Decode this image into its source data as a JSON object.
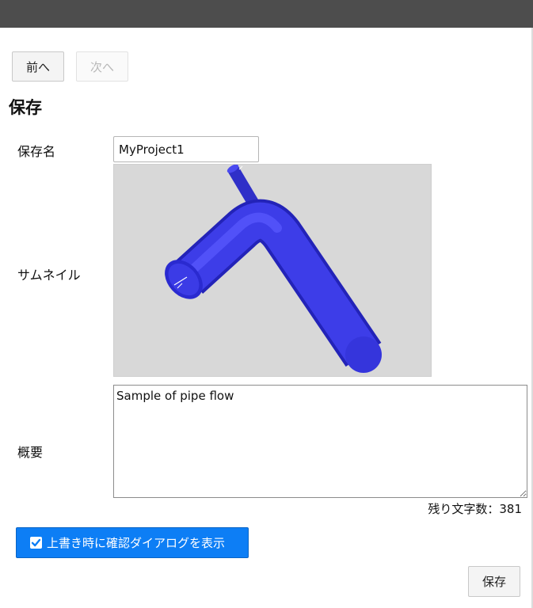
{
  "nav": {
    "prev_label": "前へ",
    "next_label": "次へ"
  },
  "page": {
    "title": "保存"
  },
  "form": {
    "name_label": "保存名",
    "name_value": "MyProject1",
    "thumbnail_label": "サムネイル",
    "description_label": "概要",
    "description_value": "Sample of pipe flow",
    "remaining_chars": "残り文字数：381",
    "confirm_dialog_label": "上書き時に確認ダイアログを表示",
    "confirm_dialog_checked": true,
    "save_label": "保存"
  },
  "colors": {
    "topbar": "#4d4d4d",
    "accent": "#0d7ef5",
    "pipe": "#3a3ae6",
    "thumbnail_bg": "#d8d8d8"
  },
  "icons": {
    "confirm_checkbox": "check-icon"
  }
}
